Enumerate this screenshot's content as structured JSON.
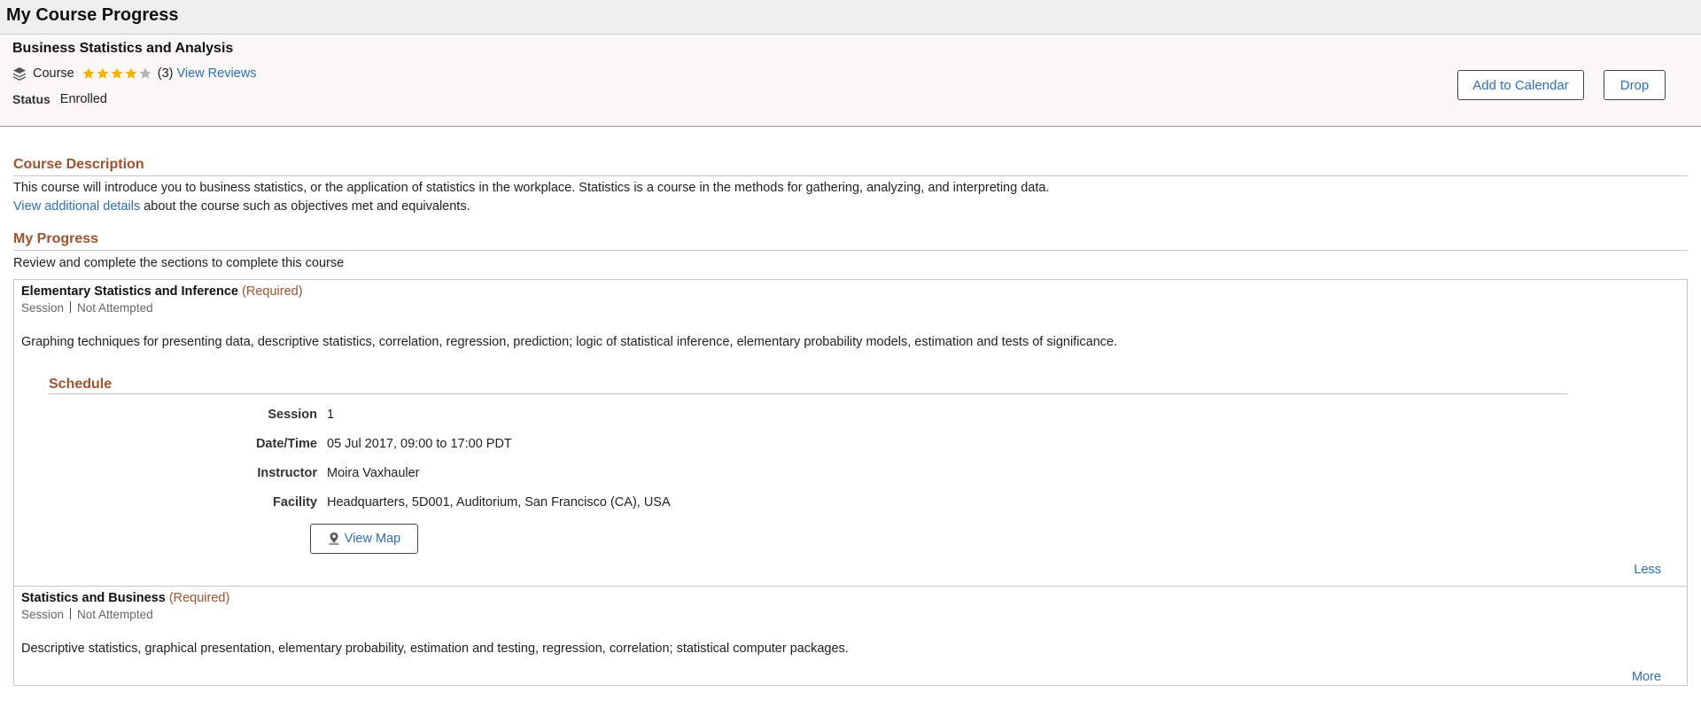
{
  "page": {
    "title": "My Course Progress"
  },
  "course": {
    "title": "Business Statistics and Analysis",
    "type_label": "Course",
    "type_icon": "stacked-books-icon",
    "rating": 4,
    "rating_max": 5,
    "review_count": "(3)",
    "view_reviews_label": "View Reviews",
    "status_label": "Status",
    "status_value": "Enrolled"
  },
  "actions": {
    "add_to_calendar": "Add to Calendar",
    "drop": "Drop"
  },
  "description": {
    "heading": "Course Description",
    "text": "This course will introduce you to business statistics, or the application of statistics in the workplace. Statistics is a course in the methods for gathering, analyzing, and interpreting data.",
    "details_link": "View additional details",
    "details_suffix": " about the course such as objectives met and equivalents."
  },
  "progress": {
    "heading": "My Progress",
    "intro": "Review and complete the sections to complete this course",
    "items": [
      {
        "title": "Elementary Statistics and Inference",
        "required": "(Required)",
        "type": "Session",
        "status": "Not Attempted",
        "description": "Graphing techniques for presenting data, descriptive statistics, correlation, regression, prediction; logic of statistical inference, elementary probability models, estimation and tests of significance.",
        "schedule": {
          "heading": "Schedule",
          "session_label": "Session",
          "session_value": "1",
          "datetime_label": "Date/Time",
          "datetime_value": "05 Jul 2017, 09:00 to 17:00 PDT",
          "instructor_label": "Instructor",
          "instructor_value": "Moira Vaxhauler",
          "facility_label": "Facility",
          "facility_value": "Headquarters, 5D001, Auditorium, San Francisco (CA), USA",
          "view_map_label": "View Map",
          "map_icon": "map-pin-icon"
        },
        "toggle_label": "Less"
      },
      {
        "title": "Statistics and Business",
        "required": "(Required)",
        "type": "Session",
        "status": "Not Attempted",
        "description": "Descriptive statistics, graphical presentation, elementary probability, estimation and testing, regression, correlation; statistical computer packages.",
        "toggle_label": "More"
      }
    ]
  },
  "colors": {
    "accent_heading": "#a0522d",
    "link": "#2f6fb5",
    "star_filled": "#f4b400",
    "star_empty": "#b5b5b5"
  }
}
